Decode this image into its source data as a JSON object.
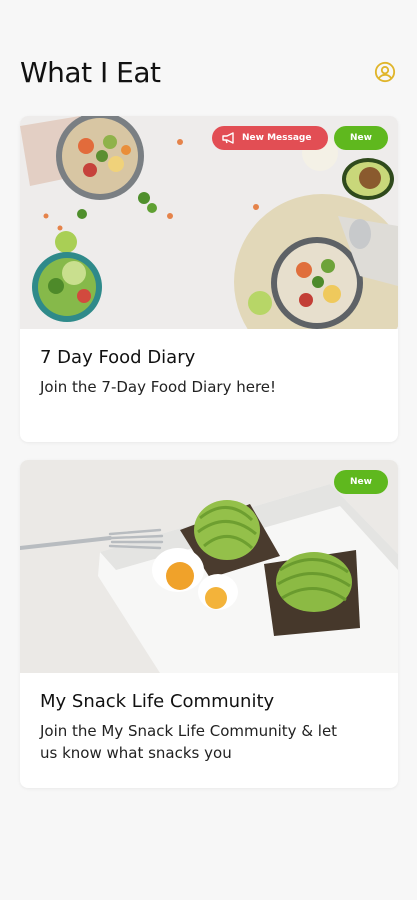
{
  "app": {
    "title": "What I Eat",
    "accent_color": "#e0b52b",
    "profile_icon": "user-circle-icon"
  },
  "cards": [
    {
      "title": "7 Day Food Diary",
      "description": "Join the 7-Day Food Diary here!",
      "badges": {
        "message": "New Message",
        "new": "New"
      },
      "image": "bowls-of-salad-photo"
    },
    {
      "title": "My Snack Life Community",
      "description": "Join the My Snack Life Community & let us know what snacks you",
      "badges": {
        "new": "New"
      },
      "image": "avocado-toast-photo"
    }
  ],
  "colors": {
    "badge_message": "#e24e54",
    "badge_new": "#5fb81e"
  }
}
